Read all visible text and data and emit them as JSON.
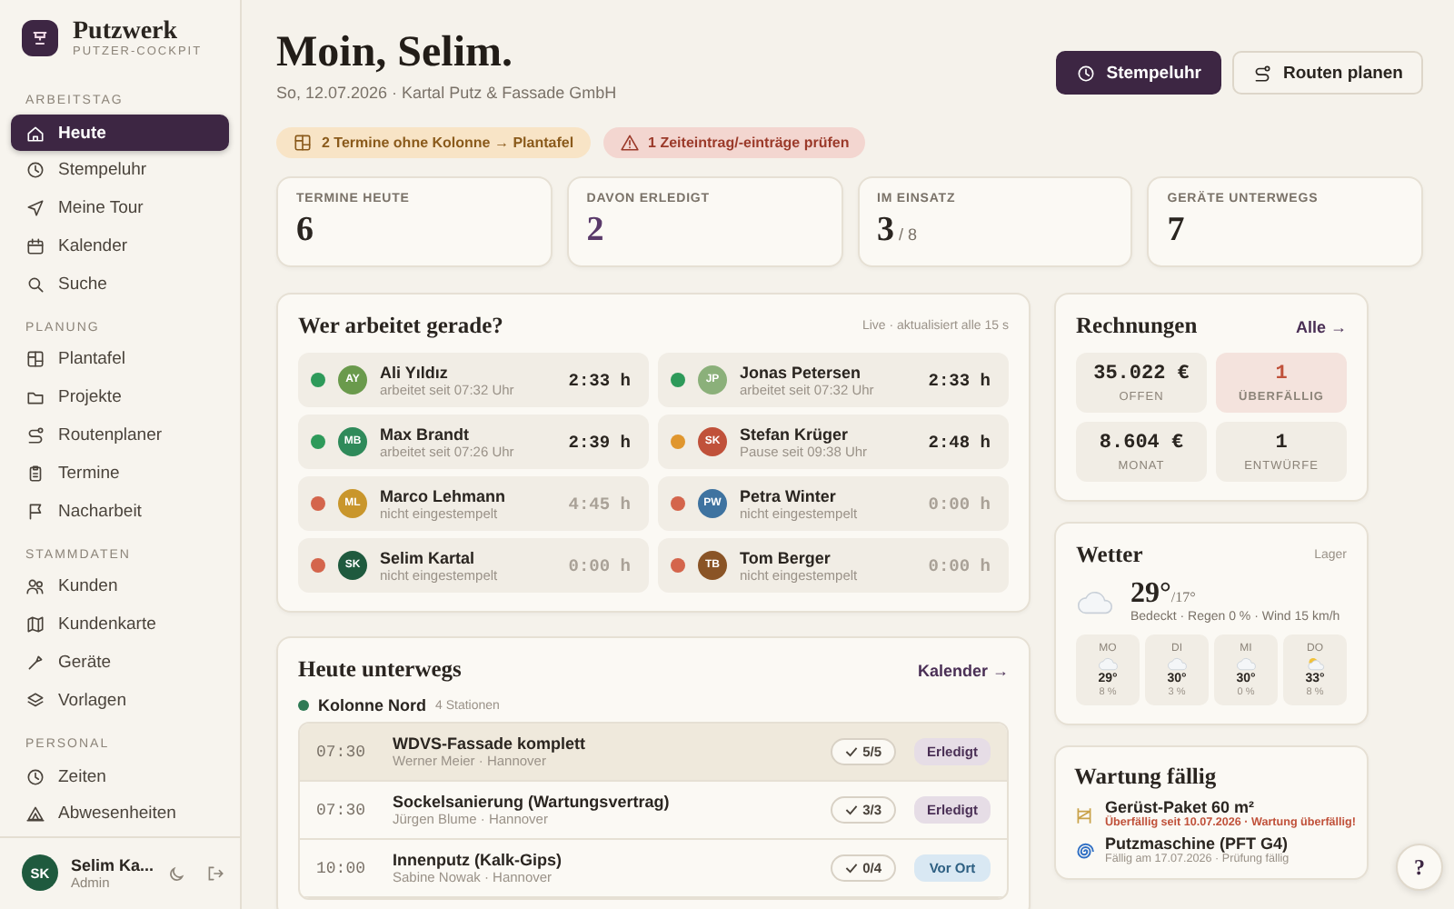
{
  "sidebar": {
    "brand": {
      "name": "Putzwerk",
      "subtitle": "PUTZER-COCKPIT"
    },
    "sections": [
      {
        "title": "ARBEITSTAG",
        "items": [
          {
            "label": "Heute",
            "selected": true
          },
          {
            "label": "Stempeluhr",
            "selected": false
          },
          {
            "label": "Meine Tour",
            "selected": false
          },
          {
            "label": "Kalender",
            "selected": false
          },
          {
            "label": "Suche",
            "selected": false
          }
        ]
      },
      {
        "title": "PLANUNG",
        "items": [
          {
            "label": "Plantafel",
            "selected": false
          },
          {
            "label": "Projekte",
            "selected": false
          },
          {
            "label": "Routenplaner",
            "selected": false
          },
          {
            "label": "Termine",
            "selected": false
          },
          {
            "label": "Nacharbeit",
            "selected": false
          }
        ]
      },
      {
        "title": "STAMMDATEN",
        "items": [
          {
            "label": "Kunden",
            "selected": false
          },
          {
            "label": "Kundenkarte",
            "selected": false
          },
          {
            "label": "Geräte",
            "selected": false
          },
          {
            "label": "Vorlagen",
            "selected": false
          }
        ]
      },
      {
        "title": "PERSONAL",
        "items": [
          {
            "label": "Zeiten",
            "selected": false
          },
          {
            "label": "Abwesenheiten",
            "selected": false
          }
        ]
      }
    ],
    "user": {
      "initials": "SK",
      "name": "Selim Ka...",
      "role": "Admin"
    }
  },
  "header": {
    "greeting": "Moin, Selim.",
    "subtitle": "So, 12.07.2026 · Kartal Putz & Fassade GmbH",
    "buttons": [
      {
        "label": "Stempeluhr",
        "kind": "primary"
      },
      {
        "label": "Routen planen",
        "kind": "secondary"
      }
    ]
  },
  "alerts": [
    {
      "label": "2 Termine ohne Kolonne → Plantafel",
      "kind": "warning"
    },
    {
      "label": "1 Zeiteintrag/-einträge prüfen",
      "kind": "danger"
    }
  ],
  "stats": [
    {
      "label": "TERMINE HEUTE",
      "value": "6",
      "accent": false
    },
    {
      "label": "DAVON ERLEDIGT",
      "value": "2",
      "accent": true
    },
    {
      "label": "IM EINSATZ",
      "value": "3",
      "suffix": "/ 8",
      "accent": false
    },
    {
      "label": "GERÄTE UNTERWEGS",
      "value": "7",
      "accent": false
    }
  ],
  "workers_panel": {
    "title": "Wer arbeitet gerade?",
    "note": "Live · aktualisiert alle 15 s",
    "workers": [
      {
        "initials": "AY",
        "name": "Ali Yıldız",
        "status_text": "arbeitet seit 07:32 Uhr",
        "time": "2:33 h",
        "kind": "working",
        "color": "#6a9a4c"
      },
      {
        "initials": "JP",
        "name": "Jonas Petersen",
        "status_text": "arbeitet seit 07:32 Uhr",
        "time": "2:33 h",
        "kind": "working",
        "color": "#8bb07a"
      },
      {
        "initials": "MB",
        "name": "Max Brandt",
        "status_text": "arbeitet seit 07:26 Uhr",
        "time": "2:39 h",
        "kind": "working",
        "color": "#2f8a5a"
      },
      {
        "initials": "SK",
        "name": "Stefan Krüger",
        "status_text": "Pause seit 09:38 Uhr",
        "time": "2:48 h",
        "kind": "break",
        "color": "#c0513a"
      },
      {
        "initials": "ML",
        "name": "Marco Lehmann",
        "status_text": "nicht eingestempelt",
        "time": "4:45 h",
        "kind": "off",
        "color": "#c9962c"
      },
      {
        "initials": "PW",
        "name": "Petra Winter",
        "status_text": "nicht eingestempelt",
        "time": "0:00 h",
        "kind": "off",
        "color": "#3f73a0"
      },
      {
        "initials": "SK",
        "name": "Selim Kartal",
        "status_text": "nicht eingestempelt",
        "time": "0:00 h",
        "kind": "off",
        "color": "#1f5a3e"
      },
      {
        "initials": "TB",
        "name": "Tom Berger",
        "status_text": "nicht eingestempelt",
        "time": "0:00 h",
        "kind": "off",
        "color": "#8a5426"
      }
    ]
  },
  "route_panel": {
    "title": "Heute unterwegs",
    "link": "Kalender →",
    "group": {
      "name": "Kolonne Nord",
      "count": "4 Stationen",
      "color": "#2f7a55"
    },
    "stops": [
      {
        "time": "07:30",
        "title": "WDVS-Fassade komplett",
        "subtitle": "Werner Meier · Hannover",
        "checks": "5/5",
        "status": "Erledigt",
        "kind": "done",
        "selected": true
      },
      {
        "time": "07:30",
        "title": "Sockelsanierung (Wartungsvertrag)",
        "subtitle": "Jürgen Blume · Hannover",
        "checks": "3/3",
        "status": "Erledigt",
        "kind": "done",
        "selected": false
      },
      {
        "time": "10:00",
        "title": "Innenputz (Kalk-Gips)",
        "subtitle": "Sabine Nowak · Hannover",
        "checks": "0/4",
        "status": "Vor Ort",
        "kind": "onsite",
        "selected": false
      }
    ]
  },
  "invoices": {
    "title": "Rechnungen",
    "link": "Alle →",
    "tiles": [
      {
        "value": "35.022 €",
        "label": "OFFEN",
        "kind": "normal"
      },
      {
        "value": "1",
        "label": "ÜBERFÄLLIG",
        "kind": "alert"
      },
      {
        "value": "8.604 €",
        "label": "MONAT",
        "kind": "normal"
      },
      {
        "value": "1",
        "label": "ENTWÜRFE",
        "kind": "normal"
      }
    ]
  },
  "weather": {
    "title": "Wetter",
    "location": "Lager",
    "temp": "29°",
    "low": "/17°",
    "description": "Bedeckt · Regen 0 % · Wind 15 km/h",
    "days": [
      {
        "day": "MO",
        "kind": "cloud",
        "temp": "29°",
        "rain": "8 %"
      },
      {
        "day": "DI",
        "kind": "cloud",
        "temp": "30°",
        "rain": "3 %"
      },
      {
        "day": "MI",
        "kind": "cloud",
        "temp": "30°",
        "rain": "0 %"
      },
      {
        "day": "DO",
        "kind": "sun_cloud",
        "temp": "33°",
        "rain": "8 %"
      }
    ]
  },
  "maintenance": {
    "title": "Wartung fällig",
    "items": [
      {
        "kind": "scaffold",
        "name": "Gerüst-Paket 60 m²",
        "detail": "Überfällig seit 10.07.2026 · Wartung überfällig!",
        "overdue": true
      },
      {
        "kind": "machine",
        "name": "Putzmaschine (PFT G4)",
        "detail": "Fällig am 17.07.2026 · Prüfung fällig",
        "overdue": false
      }
    ]
  },
  "help": {
    "label": "?"
  }
}
